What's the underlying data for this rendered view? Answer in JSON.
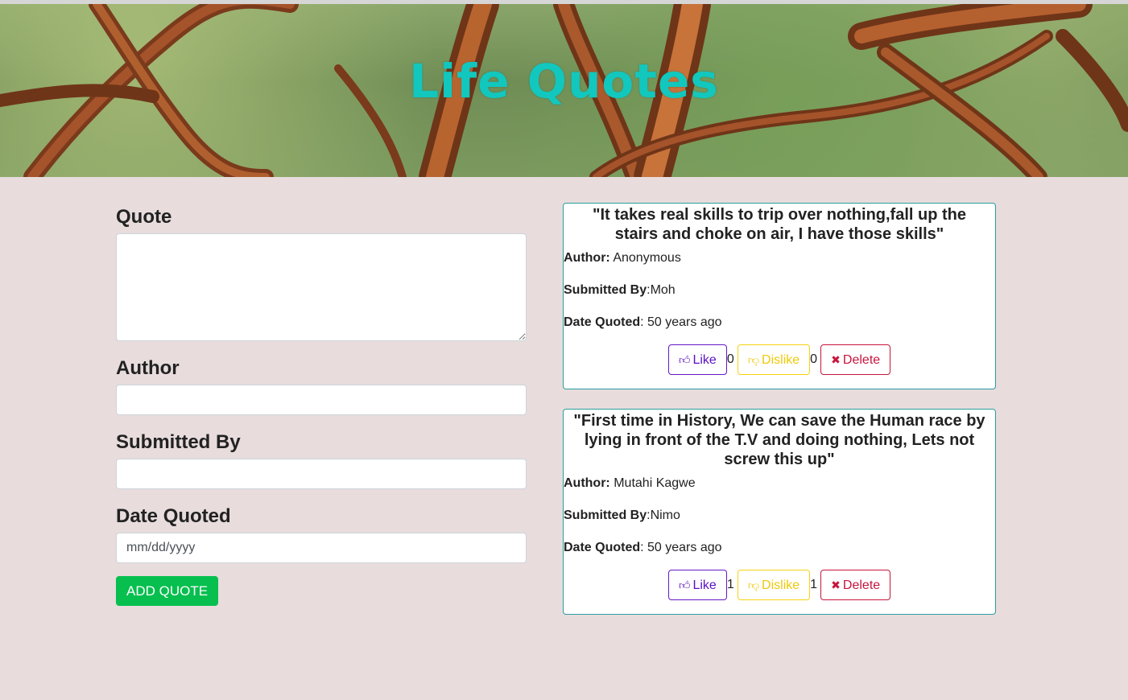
{
  "header": {
    "title": "Life Quotes"
  },
  "form": {
    "quote_label": "Quote",
    "author_label": "Author",
    "submitted_by_label": "Submitted By",
    "date_label": "Date Quoted",
    "date_placeholder": "mm/dd/yyyy",
    "submit_label": "ADD QUOTE"
  },
  "quotes": [
    {
      "text": "\"It takes real skills to trip over nothing,fall up the stairs and choke on air, I have those skills\"",
      "author_label": "Author:",
      "author": "Anonymous",
      "submitted_label": "Submitted By",
      "submitted_by": ":Moh",
      "date_label": "Date Quoted",
      "date": ": 50 years ago",
      "like_label": "Like",
      "likes": "0",
      "dislike_label": "Dislike",
      "dislikes": "0",
      "delete_label": "Delete"
    },
    {
      "text": "\"First time in History, We can save the Human race by lying in front of the T.V and doing nothing, Lets not screw this up\"",
      "author_label": "Author:",
      "author": "Mutahi Kagwe",
      "submitted_label": "Submitted By",
      "submitted_by": ":Nimo",
      "date_label": "Date Quoted",
      "date": ": 50 years ago",
      "like_label": "Like",
      "likes": "1",
      "dislike_label": "Dislike",
      "dislikes": "1",
      "delete_label": "Delete"
    }
  ],
  "icons": {
    "like": "thumbs-up-icon",
    "dislike": "thumbs-down-icon",
    "delete": "close-icon"
  },
  "colors": {
    "title": "#12c7bd",
    "page_bg": "#e8dcdd",
    "card_border": "#2a9d9f",
    "add_button": "#06bf4e",
    "like": "#5d10c2",
    "dislike": "#f0c90a",
    "delete": "#c8153c"
  }
}
